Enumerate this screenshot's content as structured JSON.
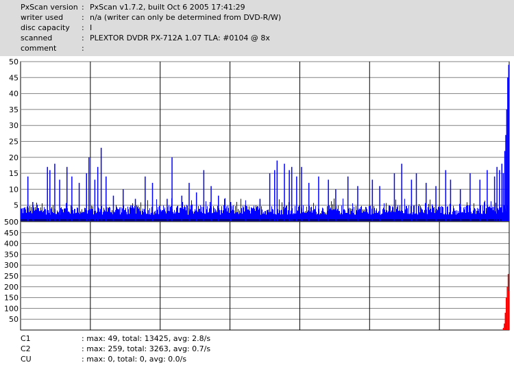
{
  "header": {
    "rows": [
      {
        "label": "PxScan version",
        "value": "PxScan v1.7.2, built Oct  6 2005 17:41:29"
      },
      {
        "label": "writer used",
        "value": "n/a (writer can only be determined from DVD-R/W)"
      },
      {
        "label": "disc capacity",
        "value": "I"
      },
      {
        "label": "scanned",
        "value": "PLEXTOR DVDR PX-712A 1.07 TLA: #0104 @ 8x"
      },
      {
        "label": "comment",
        "value": ""
      }
    ],
    "colon": ":"
  },
  "chart_data": [
    {
      "type": "bar",
      "name": "C1",
      "color": "#0000ff",
      "ylim": [
        0,
        50
      ],
      "yticks": [
        "50",
        "45",
        "40",
        "35",
        "30",
        "25",
        "20",
        "15",
        "10",
        "5"
      ],
      "grid": true,
      "peaks": [
        {
          "pos": 0.015,
          "value": 14
        },
        {
          "pos": 0.025,
          "value": 6
        },
        {
          "pos": 0.055,
          "value": 17
        },
        {
          "pos": 0.06,
          "value": 16
        },
        {
          "pos": 0.07,
          "value": 18
        },
        {
          "pos": 0.08,
          "value": 13
        },
        {
          "pos": 0.095,
          "value": 17
        },
        {
          "pos": 0.105,
          "value": 14
        },
        {
          "pos": 0.12,
          "value": 12
        },
        {
          "pos": 0.135,
          "value": 15
        },
        {
          "pos": 0.14,
          "value": 20
        },
        {
          "pos": 0.152,
          "value": 13
        },
        {
          "pos": 0.158,
          "value": 17
        },
        {
          "pos": 0.165,
          "value": 23
        },
        {
          "pos": 0.175,
          "value": 14
        },
        {
          "pos": 0.19,
          "value": 8
        },
        {
          "pos": 0.21,
          "value": 10
        },
        {
          "pos": 0.235,
          "value": 7
        },
        {
          "pos": 0.255,
          "value": 14
        },
        {
          "pos": 0.27,
          "value": 12
        },
        {
          "pos": 0.3,
          "value": 7
        },
        {
          "pos": 0.31,
          "value": 20
        },
        {
          "pos": 0.33,
          "value": 8
        },
        {
          "pos": 0.345,
          "value": 12
        },
        {
          "pos": 0.36,
          "value": 9
        },
        {
          "pos": 0.375,
          "value": 16
        },
        {
          "pos": 0.39,
          "value": 11
        },
        {
          "pos": 0.405,
          "value": 8
        },
        {
          "pos": 0.43,
          "value": 6
        },
        {
          "pos": 0.46,
          "value": 5
        },
        {
          "pos": 0.49,
          "value": 7
        },
        {
          "pos": 0.51,
          "value": 15
        },
        {
          "pos": 0.52,
          "value": 16
        },
        {
          "pos": 0.525,
          "value": 19
        },
        {
          "pos": 0.54,
          "value": 18
        },
        {
          "pos": 0.55,
          "value": 16
        },
        {
          "pos": 0.555,
          "value": 17
        },
        {
          "pos": 0.565,
          "value": 14
        },
        {
          "pos": 0.575,
          "value": 17
        },
        {
          "pos": 0.59,
          "value": 12
        },
        {
          "pos": 0.61,
          "value": 14
        },
        {
          "pos": 0.63,
          "value": 13
        },
        {
          "pos": 0.645,
          "value": 10
        },
        {
          "pos": 0.67,
          "value": 14
        },
        {
          "pos": 0.69,
          "value": 11
        },
        {
          "pos": 0.72,
          "value": 13
        },
        {
          "pos": 0.735,
          "value": 11
        },
        {
          "pos": 0.765,
          "value": 15
        },
        {
          "pos": 0.78,
          "value": 18
        },
        {
          "pos": 0.8,
          "value": 13
        },
        {
          "pos": 0.81,
          "value": 15
        },
        {
          "pos": 0.83,
          "value": 12
        },
        {
          "pos": 0.85,
          "value": 11
        },
        {
          "pos": 0.87,
          "value": 16
        },
        {
          "pos": 0.88,
          "value": 13
        },
        {
          "pos": 0.9,
          "value": 10
        },
        {
          "pos": 0.92,
          "value": 15
        },
        {
          "pos": 0.94,
          "value": 13
        },
        {
          "pos": 0.955,
          "value": 16
        },
        {
          "pos": 0.97,
          "value": 14
        },
        {
          "pos": 0.975,
          "value": 17
        },
        {
          "pos": 0.98,
          "value": 16
        },
        {
          "pos": 0.985,
          "value": 18
        },
        {
          "pos": 0.988,
          "value": 15
        },
        {
          "pos": 0.991,
          "value": 22
        },
        {
          "pos": 0.993,
          "value": 27
        },
        {
          "pos": 0.995,
          "value": 35
        },
        {
          "pos": 0.997,
          "value": 45
        },
        {
          "pos": 0.999,
          "value": 49
        }
      ],
      "baseline_level": [
        2,
        5
      ]
    },
    {
      "type": "bar",
      "name": "C2",
      "color": "#ff0000",
      "ylim": [
        0,
        500
      ],
      "yticks": [
        "500",
        "450",
        "400",
        "350",
        "300",
        "250",
        "200",
        "150",
        "100",
        "50"
      ],
      "grid": true,
      "peaks": [
        {
          "pos": 0.988,
          "value": 10
        },
        {
          "pos": 0.99,
          "value": 30
        },
        {
          "pos": 0.992,
          "value": 80
        },
        {
          "pos": 0.994,
          "value": 150
        },
        {
          "pos": 0.996,
          "value": 200
        },
        {
          "pos": 0.998,
          "value": 259
        },
        {
          "pos": 0.999,
          "value": 180
        }
      ]
    }
  ],
  "footer": {
    "rows": [
      {
        "label": "C1",
        "value": ": max: 49, total: 13425, avg: 2.8/s"
      },
      {
        "label": "C2",
        "value": ": max: 259, total: 3263, avg: 0.7/s"
      },
      {
        "label": "CU",
        "value": ": max: 0, total: 0, avg: 0.0/s"
      }
    ]
  }
}
